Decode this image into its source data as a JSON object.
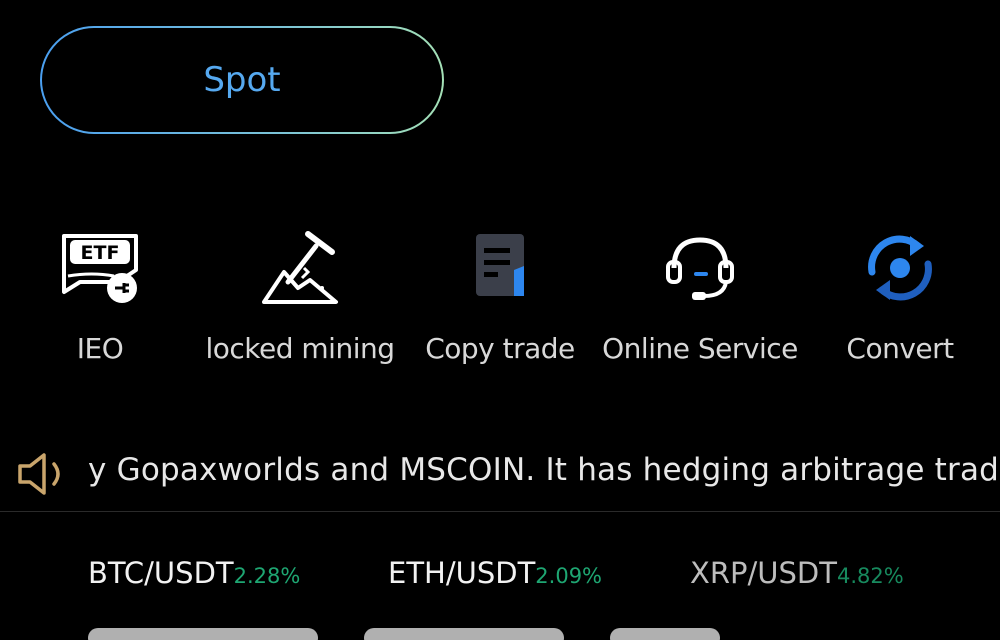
{
  "spot_button": {
    "label": "Spot"
  },
  "actions": [
    {
      "label": "IEO",
      "icon": "etf-icon"
    },
    {
      "label": "locked mining",
      "icon": "mining-pickaxe-icon"
    },
    {
      "label": "Copy trade",
      "icon": "document-icon"
    },
    {
      "label": "Online Service",
      "icon": "headset-icon"
    },
    {
      "label": "Convert",
      "icon": "convert-arrows-icon"
    }
  ],
  "etf_badge": "ETF",
  "announcement": {
    "icon": "speaker-icon",
    "text": "y Gopaxworlds and MSCOIN. It has hedging arbitrage trad"
  },
  "tickers": [
    {
      "pair": "BTC/USDT",
      "change": "2.28%"
    },
    {
      "pair": "ETH/USDT",
      "change": "2.09%"
    },
    {
      "pair": "XRP/USDT",
      "change": "4.82%"
    }
  ],
  "colors": {
    "background": "#000000",
    "accent_blue": "#56a9f0",
    "positive_green": "#1ea672",
    "speaker_gold": "#c9a56c"
  }
}
